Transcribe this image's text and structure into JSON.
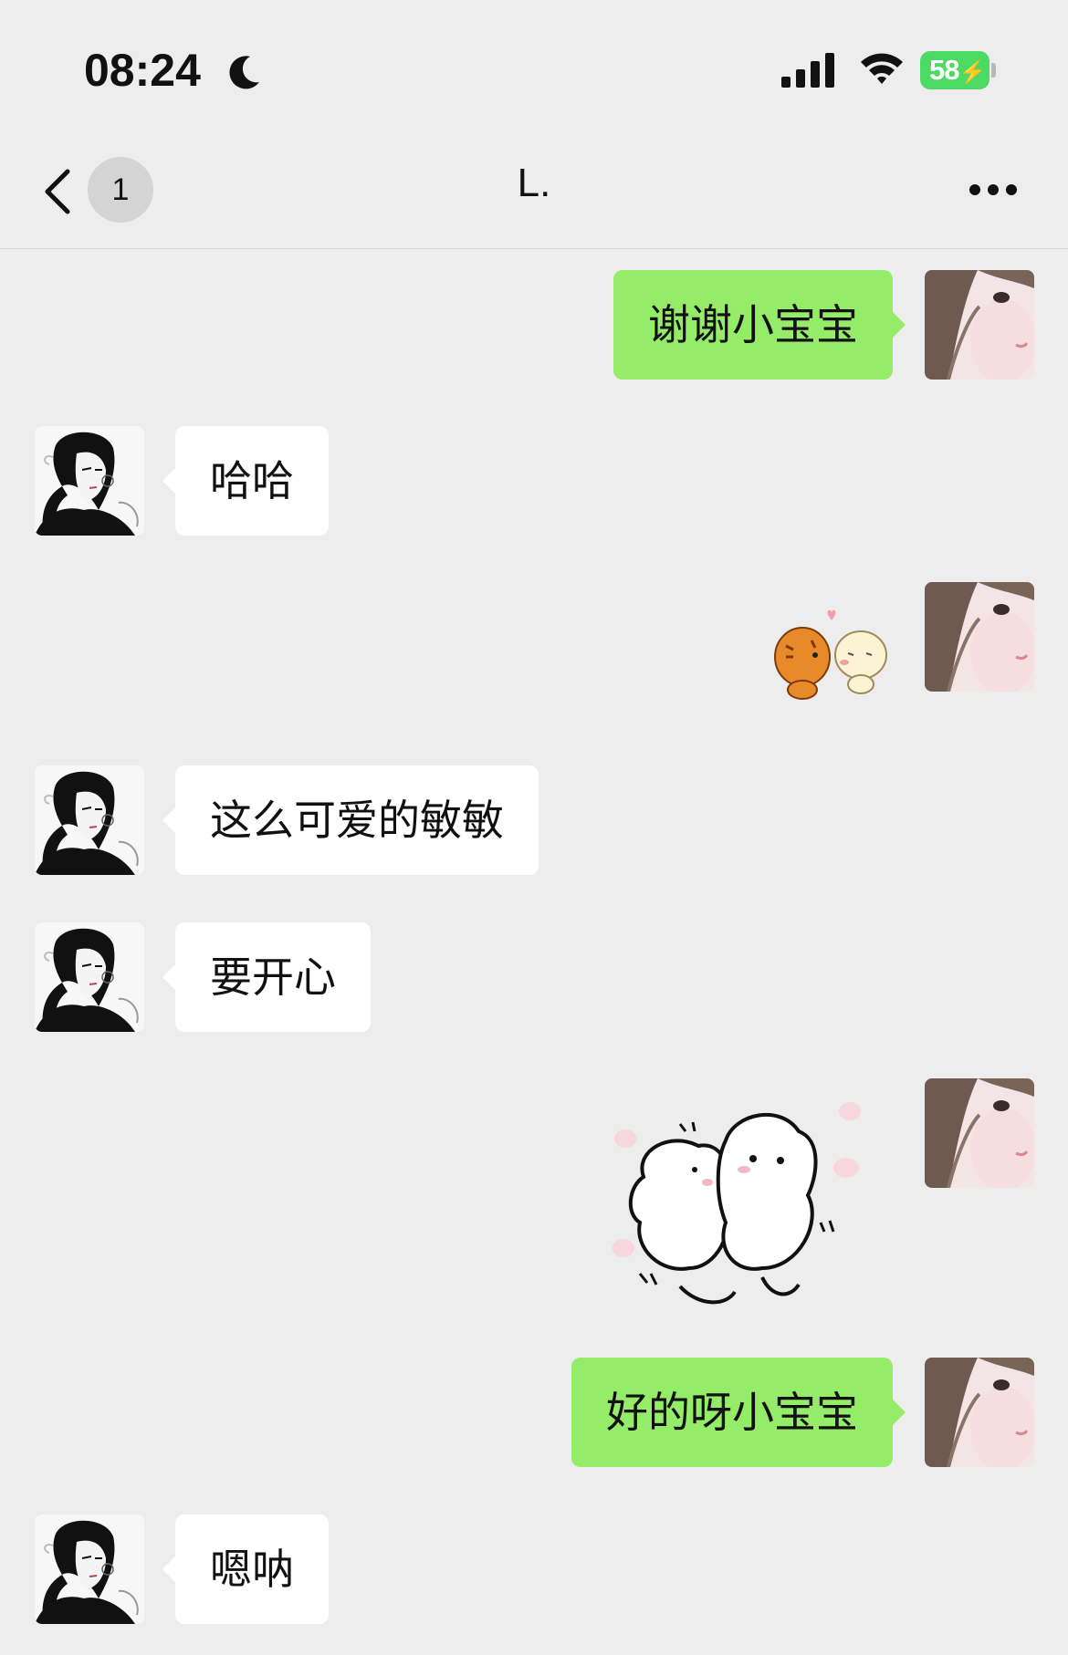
{
  "status_bar": {
    "time": "08:24",
    "battery_level": "58",
    "battery_charging_glyph": "⚡"
  },
  "nav": {
    "unread_count": "1",
    "title": "L."
  },
  "messages": [
    {
      "from": "me",
      "type": "text",
      "text": "谢谢小宝宝"
    },
    {
      "from": "contact",
      "type": "text",
      "text": "哈哈"
    },
    {
      "from": "me",
      "type": "sticker",
      "sticker": "tiger-and-cat-kiss-sticker"
    },
    {
      "from": "contact",
      "type": "text",
      "text": "这么可爱的敏敏"
    },
    {
      "from": "contact",
      "type": "text",
      "text": "要开心"
    },
    {
      "from": "me",
      "type": "sticker",
      "sticker": "two-bears-hug-sticker"
    },
    {
      "from": "me",
      "type": "text",
      "text": "好的呀小宝宝"
    },
    {
      "from": "contact",
      "type": "text",
      "text": "嗯呐"
    }
  ],
  "colors": {
    "background": "#ededed",
    "outgoing_bubble": "#95ec69",
    "incoming_bubble": "#ffffff",
    "battery": "#4cd964"
  }
}
